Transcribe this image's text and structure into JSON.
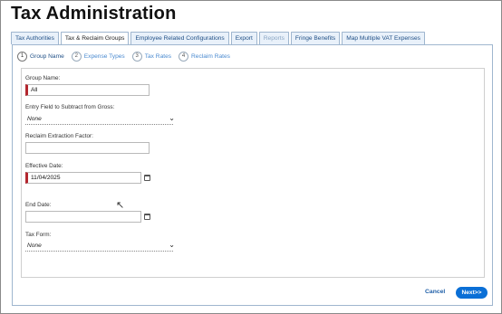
{
  "title": "Tax Administration",
  "tabs": [
    {
      "label": "Tax Authorities",
      "state": "normal"
    },
    {
      "label": "Tax & Reclaim Groups",
      "state": "active"
    },
    {
      "label": "Employee Related Configurations",
      "state": "normal"
    },
    {
      "label": "Export",
      "state": "normal"
    },
    {
      "label": "Reports",
      "state": "disabled"
    },
    {
      "label": "Fringe Benefits",
      "state": "normal"
    },
    {
      "label": "Map Multiple VAT Expenses",
      "state": "normal"
    }
  ],
  "steps": [
    {
      "num": "1",
      "label": "Group Name",
      "active": true
    },
    {
      "num": "2",
      "label": "Expense Types",
      "active": false
    },
    {
      "num": "3",
      "label": "Tax Rates",
      "active": false
    },
    {
      "num": "4",
      "label": "Reclaim Rates",
      "active": false
    }
  ],
  "form": {
    "group_name_label": "Group Name:",
    "group_name_value": "All",
    "entry_field_label": "Entry Field to Subtract from Gross:",
    "entry_field_value": "None",
    "reclaim_factor_label": "Reclaim Extraction Factor:",
    "reclaim_factor_value": "",
    "effective_date_label": "Effective Date:",
    "effective_date_value": "11/04/2025",
    "end_date_label": "End Date:",
    "end_date_value": "",
    "tax_form_label": "Tax Form:",
    "tax_form_value": "None"
  },
  "icons": {
    "chevron": "chevron-down-icon",
    "calendar": "calendar-icon",
    "cursor": "mouse-pointer-icon"
  },
  "buttons": {
    "cancel": "Cancel",
    "next": "Next>>"
  },
  "colors": {
    "accent": "#0a6fd6",
    "required": "#b3262e",
    "tab_bg": "#e9f1fa",
    "link": "#1f5fa8"
  }
}
